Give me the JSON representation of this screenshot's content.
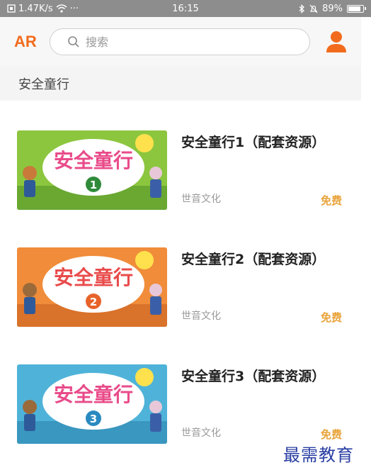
{
  "status_bar": {
    "network_speed": "1.47K/s",
    "dots": "···",
    "time": "16:15",
    "battery": "89%",
    "battery_level": 0.89
  },
  "header": {
    "logo": "AR",
    "search_placeholder": "搜索"
  },
  "section": {
    "title": "安全童行"
  },
  "items": [
    {
      "title": "安全童行1（配套资源）",
      "publisher": "世音文化",
      "price": "免费",
      "cover_text": "安全童行",
      "cover_number": "1",
      "cover_bg": "#8cc63f"
    },
    {
      "title": "安全童行2（配套资源）",
      "publisher": "世音文化",
      "price": "免费",
      "cover_text": "安全童行",
      "cover_number": "2",
      "cover_bg": "#f08c3a"
    },
    {
      "title": "安全童行3（配套资源）",
      "publisher": "世音文化",
      "price": "免费",
      "cover_text": "安全童行",
      "cover_number": "3",
      "cover_bg": "#4fb3d9"
    }
  ],
  "watermark": "最需教育",
  "colors": {
    "accent": "#f26b1d",
    "price": "#e8a33a"
  }
}
